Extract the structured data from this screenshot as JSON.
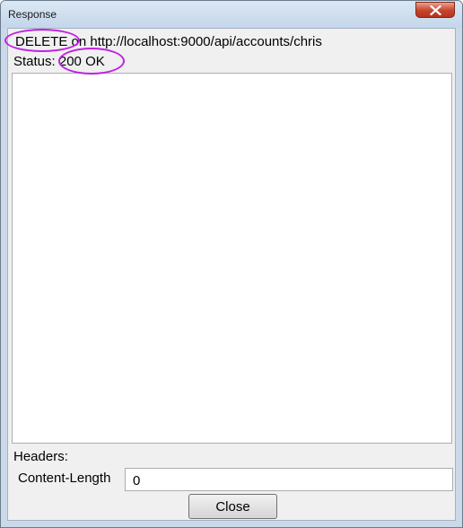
{
  "window": {
    "title": "Response",
    "close_icon": "close-x-icon"
  },
  "request": {
    "method": "DELETE",
    "connector": "on",
    "url": "http://localhost:9000/api/accounts/chris"
  },
  "status": {
    "label": "Status:",
    "value": "200 OK"
  },
  "body": {
    "content": ""
  },
  "headers": {
    "label": "Headers:",
    "items": [
      {
        "name": "Content-Length",
        "value": "0"
      }
    ]
  },
  "actions": {
    "close_label": "Close"
  },
  "annotation": {
    "highlight_color": "#c020e0"
  }
}
